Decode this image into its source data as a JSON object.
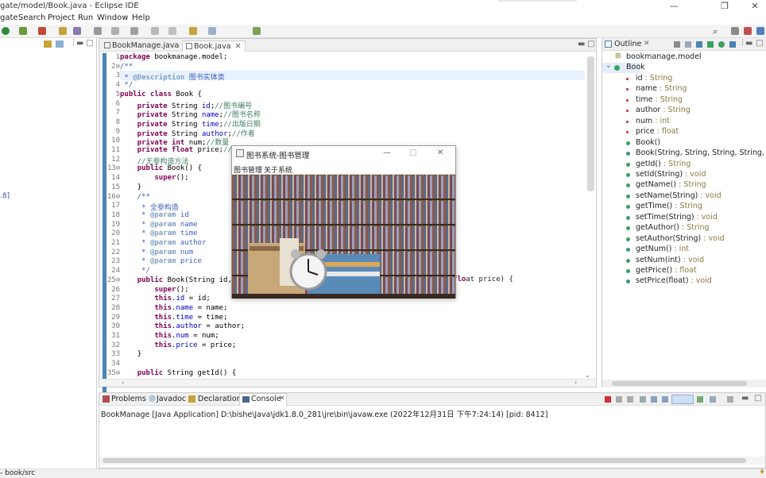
{
  "window": {
    "title": "gate/model/Book.java - Eclipse IDE"
  },
  "menu": [
    "gate",
    "Search",
    "Project",
    "Run",
    "Window",
    "Help"
  ],
  "editor": {
    "tabs": [
      "BookManage.java",
      "Book.java"
    ],
    "lines": [
      {
        "n": "1",
        "text": "package bookmanage.model;"
      },
      {
        "n": "2⊖",
        "text": "/**"
      },
      {
        "n": "3",
        "text": " * @Description 图书实体类"
      },
      {
        "n": "4",
        "text": " */"
      },
      {
        "n": "5",
        "text": "public class Book {"
      },
      {
        "n": "6",
        "text": "    private String id;//图书编号"
      },
      {
        "n": "7",
        "text": "    private String name;//图书名称"
      },
      {
        "n": "8",
        "text": "    private String time;//出版日期"
      },
      {
        "n": "9",
        "text": "    private String author;//作者"
      },
      {
        "n": "10",
        "text": "    private int num;//数量"
      },
      {
        "n": "11",
        "text": "    private float price;//"
      },
      {
        "n": "12",
        "text": "    //无参构造方法"
      },
      {
        "n": "13⊖",
        "text": "    public Book() {"
      },
      {
        "n": "14",
        "text": "        super();"
      },
      {
        "n": "15",
        "text": "    }"
      },
      {
        "n": "16⊖",
        "text": "    /**"
      },
      {
        "n": "17",
        "text": "     * 全参构造"
      },
      {
        "n": "18",
        "text": "     * @param id"
      },
      {
        "n": "19",
        "text": "     * @param name"
      },
      {
        "n": "20",
        "text": "     * @param time"
      },
      {
        "n": "21",
        "text": "     * @param author"
      },
      {
        "n": "22",
        "text": "     * @param num"
      },
      {
        "n": "23",
        "text": "     * @param price"
      },
      {
        "n": "24",
        "text": "     */"
      },
      {
        "n": "25⊖",
        "text": "    public Book(String id,"
      },
      {
        "n": "26",
        "text": "        super();"
      },
      {
        "n": "27",
        "text": "        this.id = id;"
      },
      {
        "n": "28",
        "text": "        this.name = name;"
      },
      {
        "n": "29",
        "text": "        this.time = time;"
      },
      {
        "n": "30",
        "text": "        this.author = author;"
      },
      {
        "n": "31",
        "text": "        this.num = num;"
      },
      {
        "n": "32",
        "text": "        this.price = price;"
      },
      {
        "n": "33",
        "text": "    }"
      },
      {
        "n": "34",
        "text": ""
      },
      {
        "n": "35⊖",
        "text": "    public String getId() {"
      }
    ],
    "line25_tail": "at price) {"
  },
  "left_panel": {
    "fragment": ".8]"
  },
  "outline": {
    "title": "Outline",
    "items": [
      {
        "name": "bookmanage.model",
        "type": ""
      },
      {
        "name": "Book",
        "type": ""
      },
      {
        "name": "id",
        "type": " : String"
      },
      {
        "name": "name",
        "type": " : String"
      },
      {
        "name": "time",
        "type": " : String"
      },
      {
        "name": "author",
        "type": " : String"
      },
      {
        "name": "num",
        "type": " : int"
      },
      {
        "name": "price",
        "type": " : float"
      },
      {
        "name": "Book()",
        "type": ""
      },
      {
        "name": "Book(String, String, String, String, int, f",
        "type": ""
      },
      {
        "name": "getId()",
        "type": " : String"
      },
      {
        "name": "setId(String)",
        "type": " : void"
      },
      {
        "name": "getName()",
        "type": " : String"
      },
      {
        "name": "setName(String)",
        "type": " : void"
      },
      {
        "name": "getTime()",
        "type": " : String"
      },
      {
        "name": "setTime(String)",
        "type": " : void"
      },
      {
        "name": "getAuthor()",
        "type": " : String"
      },
      {
        "name": "setAuthor(String)",
        "type": " : void"
      },
      {
        "name": "getNum()",
        "type": " : int"
      },
      {
        "name": "setNum(int)",
        "type": " : void"
      },
      {
        "name": "getPrice()",
        "type": " : float"
      },
      {
        "name": "setPrice(float)",
        "type": " : void"
      }
    ]
  },
  "popup": {
    "title": "图书系统-图书管理",
    "menu": [
      "图书管理",
      "关于系统"
    ]
  },
  "console": {
    "tabs": [
      "Problems",
      "Javadoc",
      "Declaration",
      "Console"
    ],
    "info": "BookManage [Java Application] D:\\bishe\\Java\\jdk1.8.0_281\\jre\\bin\\javaw.exe  (2022年12月31日 下午7:24:14) [pid: 8412]"
  },
  "status": {
    "path": "- book/src"
  },
  "colors": {
    "keyword": "#7f0055",
    "comment": "#3f7f5f",
    "javadoc": "#3f5fbf",
    "field": "#0000c0",
    "accent": "#4b84b4"
  }
}
